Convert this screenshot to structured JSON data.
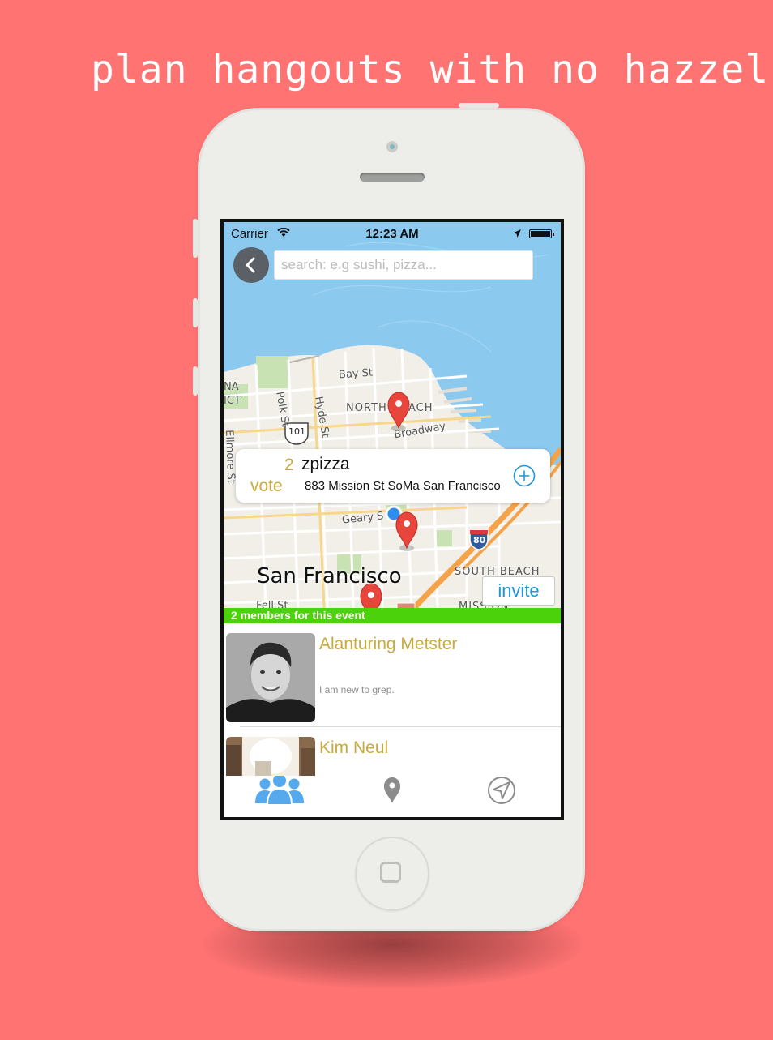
{
  "headline": "plan hangouts with no hazzel!",
  "status_bar": {
    "carrier": "Carrier",
    "time": "12:23 AM"
  },
  "search": {
    "placeholder": "search: e.g sushi, pizza..."
  },
  "map": {
    "city_label": "San Francisco",
    "street_labels": [
      "Bay St",
      "NORTH",
      "ACH",
      "Broadway",
      "Polk St",
      "Hyde St",
      "Ellmore St",
      "Geary S",
      "SOUTH BEACH",
      "Fell St",
      "MISSION",
      "NA",
      "ICT",
      "101",
      "80"
    ]
  },
  "callout": {
    "vote_count": "2",
    "vote_label": "vote",
    "place_name": "zpizza",
    "address": "883 Mission St SoMa San Francisco"
  },
  "invite_label": "invite",
  "members_banner": "2 members for this event",
  "members": [
    {
      "name": "Alanturing Metster",
      "bio": "I am new to grep."
    },
    {
      "name": "Kim Neul",
      "bio": ""
    }
  ],
  "tabs": [
    "members-tab",
    "places-tab",
    "navigate-tab"
  ],
  "colors": {
    "background": "#ff7373",
    "accent_blue": "#1e97d6",
    "vote_gold": "#c9aa3b",
    "banner_green": "#4cd20b",
    "pin_red": "#e8453c"
  }
}
